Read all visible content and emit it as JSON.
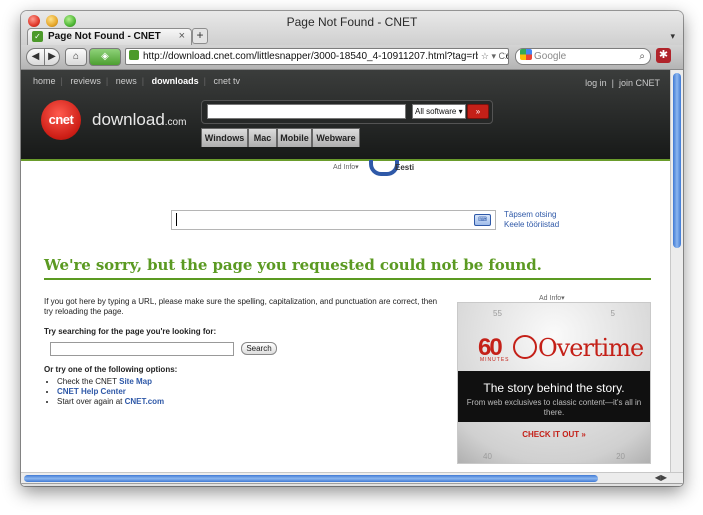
{
  "window": {
    "title": "Page Not Found - CNET"
  },
  "tabs": [
    {
      "label": "Page Not Found - CNET",
      "close": "×"
    }
  ],
  "new_tab": "+",
  "tab_list_arrow": "▾",
  "navbar": {
    "back": "◀",
    "forward": "▶",
    "home": "⌂",
    "url": "http://download.cnet.com/littlesnapper/3000-18540_4-10911207.html?tag=rb_conte",
    "url_icons": "☆ ▾ C",
    "search_placeholder": "Google",
    "search_icon": "⌕",
    "addon_label": "✱"
  },
  "cnet": {
    "topnav": [
      "home",
      "reviews",
      "news",
      "downloads",
      "cnet tv"
    ],
    "active_nav": "downloads",
    "login": "log in",
    "join": "join CNET",
    "logo_badge": "cnet",
    "logo_text": "download",
    "logo_suffix": ".com",
    "search_select": "All software",
    "search_go": "»",
    "subtabs": [
      "Windows",
      "Mac",
      "Mobile",
      "Webware"
    ]
  },
  "top_ad": {
    "ad_info": "Ad Info▾",
    "brand_text": "Eesti"
  },
  "search_box": {
    "links": [
      "Täpsem otsing",
      "Keele tööriistad"
    ],
    "keyboard_icon": "⌨"
  },
  "error": {
    "heading": "We're sorry, but the page you requested could not be found.",
    "paragraph": "If you got here by typing a URL, please make sure the spelling, capitalization, and punctuation are correct, then try reloading the page.",
    "try_label": "Try searching for the page you're looking for:",
    "search_button": "Search",
    "options_label": "Or try one of the following options:",
    "options": [
      {
        "prefix": "Check the CNET ",
        "link": "Site Map"
      },
      {
        "prefix": "",
        "link": "CNET Help Center"
      },
      {
        "prefix": "Start over again at ",
        "link": "CNET.com"
      }
    ]
  },
  "side_ad": {
    "ad_info": "Ad Info▾",
    "dial_left": "55",
    "dial_right": "5",
    "sixty": "60",
    "minutes": "MINUTES",
    "overtime": "Overtime",
    "headline": "The story behind the story.",
    "subline": "From web exclusives to classic content—it's all in there.",
    "cta": "CHECK IT OUT »",
    "dial_bottom_left": "40",
    "dial_bottom_right": "20"
  },
  "statusbar": {
    "close": "×",
    "icons": "☆☆☆☆☆ ✱"
  }
}
